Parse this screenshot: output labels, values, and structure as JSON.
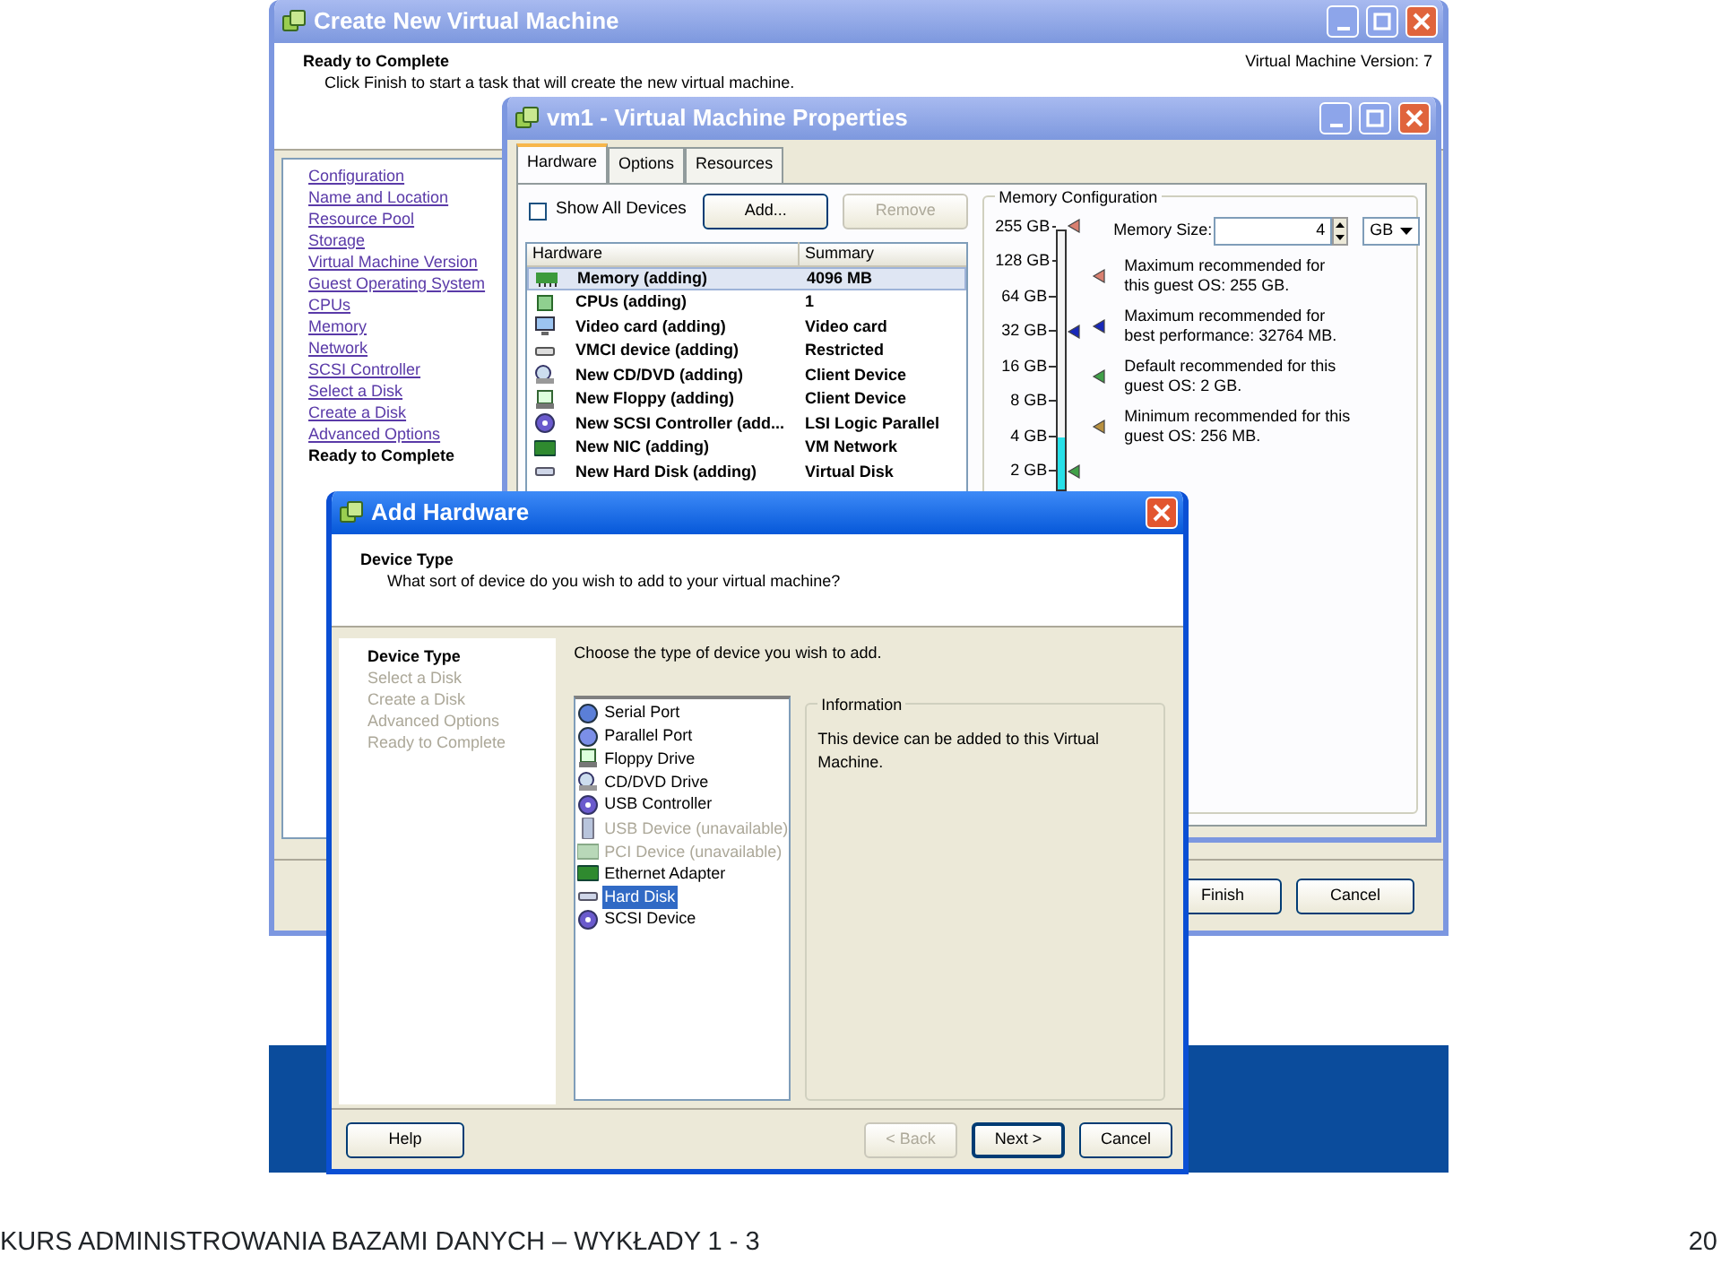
{
  "create_vm_window": {
    "title": "Create New Virtual Machine",
    "active": false,
    "title_buttons": [
      {
        "kind": "minimize"
      },
      {
        "kind": "maximize"
      },
      {
        "kind": "close"
      }
    ],
    "heading": "Ready to Complete",
    "subheading": "Click Finish to start a task that will create the new virtual machine.",
    "version_label": "Virtual Machine Version: 7",
    "steps": [
      {
        "label": "Configuration",
        "selected": false
      },
      {
        "label": "Name and Location",
        "selected": false
      },
      {
        "label": "Resource Pool",
        "selected": false
      },
      {
        "label": "Storage",
        "selected": false
      },
      {
        "label": "Virtual Machine Version",
        "selected": false
      },
      {
        "label": "Guest Operating System",
        "selected": false
      },
      {
        "label": "CPUs",
        "selected": false
      },
      {
        "label": "Memory",
        "selected": false
      },
      {
        "label": "Network",
        "selected": false
      },
      {
        "label": "SCSI Controller",
        "selected": false
      },
      {
        "label": "Select a Disk",
        "selected": false
      },
      {
        "label": "Create a Disk",
        "selected": false
      },
      {
        "label": "Advanced Options",
        "selected": false
      },
      {
        "label": "Ready to Complete",
        "selected": true
      }
    ],
    "buttons": [
      {
        "label": "Finish",
        "disabled": false
      },
      {
        "label": "Cancel",
        "disabled": false
      }
    ]
  },
  "properties_window": {
    "title": "vm1 - Virtual Machine Properties",
    "active": false,
    "title_buttons": [
      {
        "kind": "minimize"
      },
      {
        "kind": "maximize"
      },
      {
        "kind": "close"
      }
    ],
    "tabs": [
      {
        "label": "Hardware",
        "selected": true
      },
      {
        "label": "Options",
        "selected": false
      },
      {
        "label": "Resources",
        "selected": false
      }
    ],
    "show_all_devices": {
      "label": "Show All Devices",
      "checked": false
    },
    "buttons": [
      {
        "label": "Add...",
        "disabled": false
      },
      {
        "label": "Remove",
        "disabled": true
      }
    ],
    "table": {
      "columns": [
        "Hardware",
        "Summary"
      ],
      "rows": [
        {
          "kind": "memory",
          "cells": [
            "Memory (adding)",
            "4096 MB"
          ],
          "selected": true
        },
        {
          "kind": "cpu",
          "cells": [
            "CPUs (adding)",
            "1"
          ],
          "selected": false
        },
        {
          "kind": "video",
          "cells": [
            "Video card  (adding)",
            "Video card"
          ],
          "selected": false
        },
        {
          "kind": "vmci",
          "cells": [
            "VMCI device (adding)",
            "Restricted"
          ],
          "selected": false
        },
        {
          "kind": "cdrom",
          "cells": [
            "New CD/DVD (adding)",
            "Client Device"
          ],
          "selected": false
        },
        {
          "kind": "floppy",
          "cells": [
            "New Floppy (adding)",
            "Client Device"
          ],
          "selected": false
        },
        {
          "kind": "scsi",
          "cells": [
            "New SCSI Controller (add...",
            "LSI Logic Parallel"
          ],
          "selected": false
        },
        {
          "kind": "nic",
          "cells": [
            "New NIC (adding)",
            "VM Network"
          ],
          "selected": false
        },
        {
          "kind": "disk",
          "cells": [
            "New Hard Disk (adding)",
            "Virtual Disk"
          ],
          "selected": false
        }
      ]
    },
    "memory_configuration": {
      "title": "Memory Configuration",
      "level": 0.2,
      "scale": [
        {
          "label": "255 GB",
          "color": "#d98070"
        },
        {
          "label": "128 GB"
        },
        {
          "label": "64 GB"
        },
        {
          "label": "32 GB",
          "color": "#1828b8"
        },
        {
          "label": "16 GB"
        },
        {
          "label": "8 GB"
        },
        {
          "label": "4 GB"
        },
        {
          "label": "2 GB",
          "color": "#40a048"
        }
      ],
      "memory_size_label": "Memory Size:",
      "memory_size_value": "4",
      "unit": "GB",
      "legend": [
        {
          "text": "Maximum recommended for this guest OS: 255 GB.",
          "color": "#d98070"
        },
        {
          "text": "Maximum recommended for best performance: 32764 MB.",
          "color": "#1828b8"
        },
        {
          "text": "Default recommended for this guest OS: 2 GB.",
          "color": "#40a048"
        },
        {
          "text": "Minimum recommended for this guest OS: 256 MB.",
          "color": "#b89040"
        }
      ]
    }
  },
  "add_hardware_window": {
    "title": "Add Hardware",
    "active": true,
    "title_buttons": [
      {
        "kind": "close"
      }
    ],
    "heading": "Device Type",
    "subheading": "What sort of device do you wish to add to your virtual machine?",
    "steps": [
      {
        "label": "Device Type",
        "selected": true
      },
      {
        "label": "Select a Disk",
        "selected": false
      },
      {
        "label": "Create a Disk",
        "selected": false
      },
      {
        "label": "Advanced Options",
        "selected": false
      },
      {
        "label": "Ready to Complete",
        "selected": false
      }
    ],
    "prompt": "Choose the type of device you wish to add.",
    "devices": [
      {
        "kind": "serial",
        "label": "Serial Port",
        "disabled": false,
        "selected": false
      },
      {
        "kind": "parallel",
        "label": "Parallel Port",
        "disabled": false,
        "selected": false
      },
      {
        "kind": "floppy",
        "label": "Floppy Drive",
        "disabled": false,
        "selected": false
      },
      {
        "kind": "cdrom",
        "label": "CD/DVD Drive",
        "disabled": false,
        "selected": false
      },
      {
        "kind": "usb_controller",
        "label": "USB Controller",
        "disabled": false,
        "selected": false
      },
      {
        "kind": "usb_device",
        "label": "USB Device (unavailable)",
        "disabled": true,
        "selected": false
      },
      {
        "kind": "pci",
        "label": "PCI Device (unavailable)",
        "disabled": true,
        "selected": false
      },
      {
        "kind": "ethernet",
        "label": "Ethernet Adapter",
        "disabled": false,
        "selected": false
      },
      {
        "kind": "disk",
        "label": "Hard Disk",
        "disabled": false,
        "selected": true
      },
      {
        "kind": "scsi",
        "label": "SCSI Device",
        "disabled": false,
        "selected": false
      }
    ],
    "information": {
      "title": "Information",
      "text": "This device can be added to this Virtual Machine."
    },
    "help_button": {
      "label": "Help",
      "disabled": false
    },
    "buttons": [
      {
        "label": "< Back",
        "disabled": true
      },
      {
        "label": "Next >",
        "disabled": false
      },
      {
        "label": "Cancel",
        "disabled": false
      }
    ]
  },
  "footer": {
    "title": "KURS ADMINISTROWANIA BAZAMI DANYCH – WYKŁADY 1 - 3",
    "page_number": "20"
  }
}
